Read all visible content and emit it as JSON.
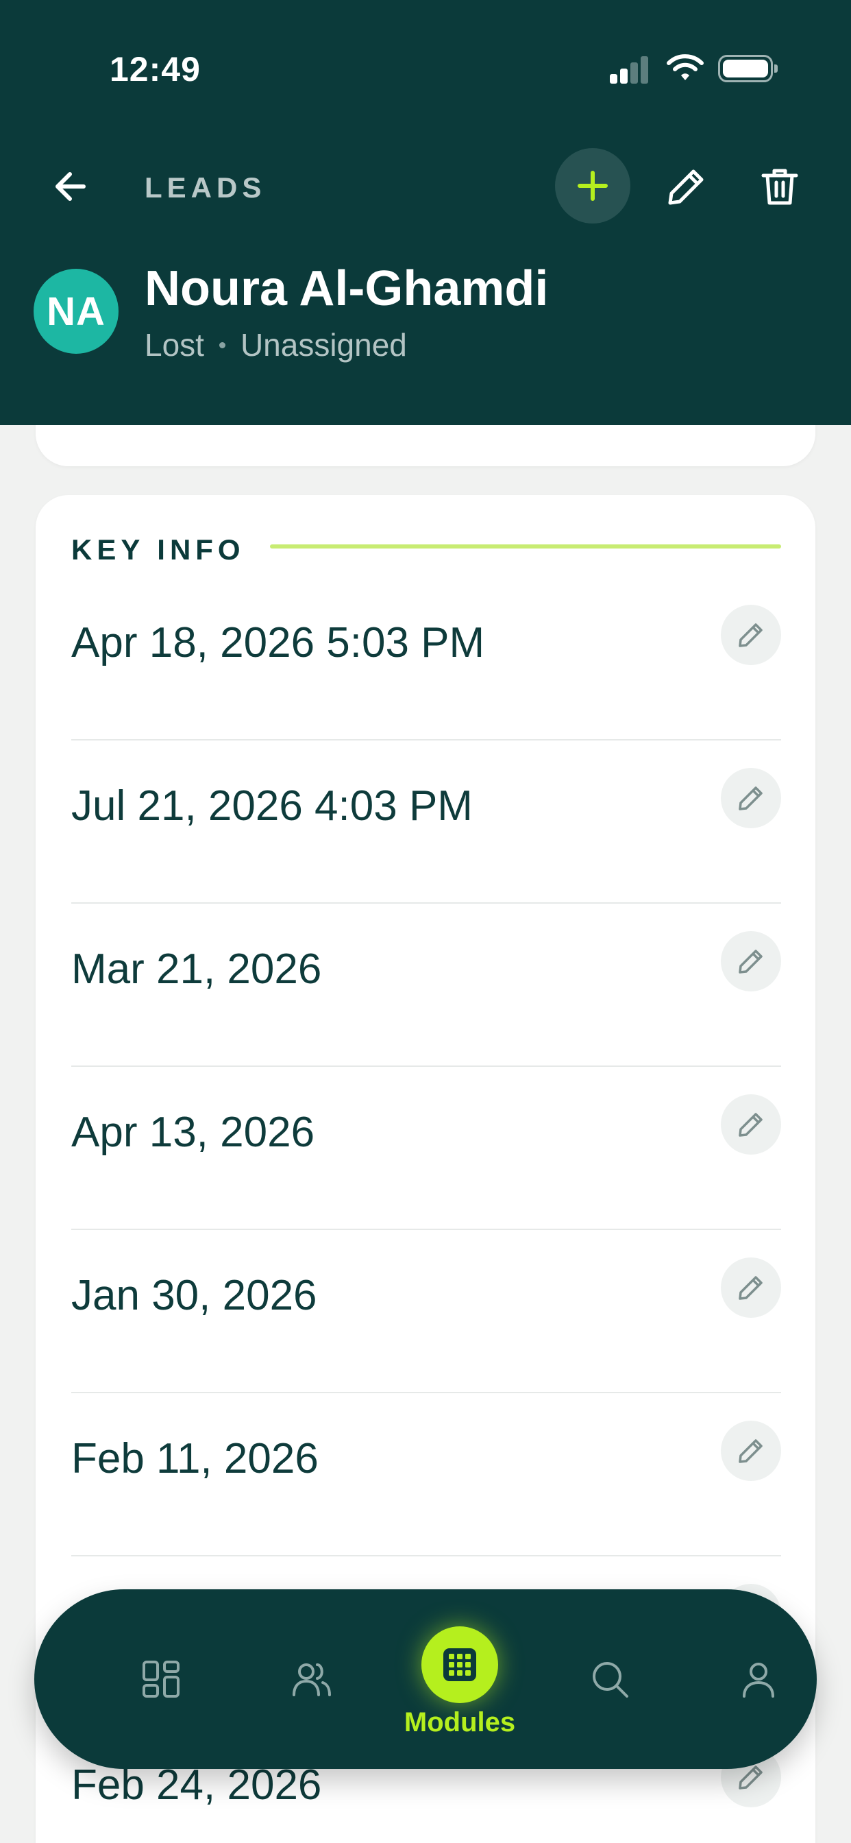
{
  "status_bar": {
    "time": "12:49"
  },
  "header": {
    "back_icon": "arrow-left-icon",
    "title": "LEADS",
    "actions": [
      "plus-icon",
      "pencil-icon",
      "trash-icon"
    ]
  },
  "contact": {
    "initials": "NA",
    "name": "Noura Al-Ghamdi",
    "status": "Lost",
    "assignee": "Unassigned"
  },
  "key_info": {
    "heading": "KEY INFO",
    "items": [
      {
        "value": "Apr 18, 2026 5:03 PM"
      },
      {
        "value": "Jul 21, 2026 4:03 PM"
      },
      {
        "value": "Mar 21, 2026"
      },
      {
        "value": "Apr 13, 2026"
      },
      {
        "value": "Jan 30, 2026"
      },
      {
        "value": "Feb 11, 2026"
      },
      {
        "value": ""
      },
      {
        "value": "Feb 24, 2026"
      }
    ]
  },
  "bottom_nav": {
    "items": [
      {
        "icon": "dashboard-icon"
      },
      {
        "icon": "users-icon"
      },
      {
        "icon": "modules-grid-icon",
        "label": "Modules",
        "active": true
      },
      {
        "icon": "search-icon"
      },
      {
        "icon": "profile-icon"
      }
    ]
  },
  "colors": {
    "header_bg": "#0b3a3a",
    "accent": "#b5ef1e",
    "avatar_bg": "#1db7a3",
    "section_line": "#c8ec72"
  }
}
